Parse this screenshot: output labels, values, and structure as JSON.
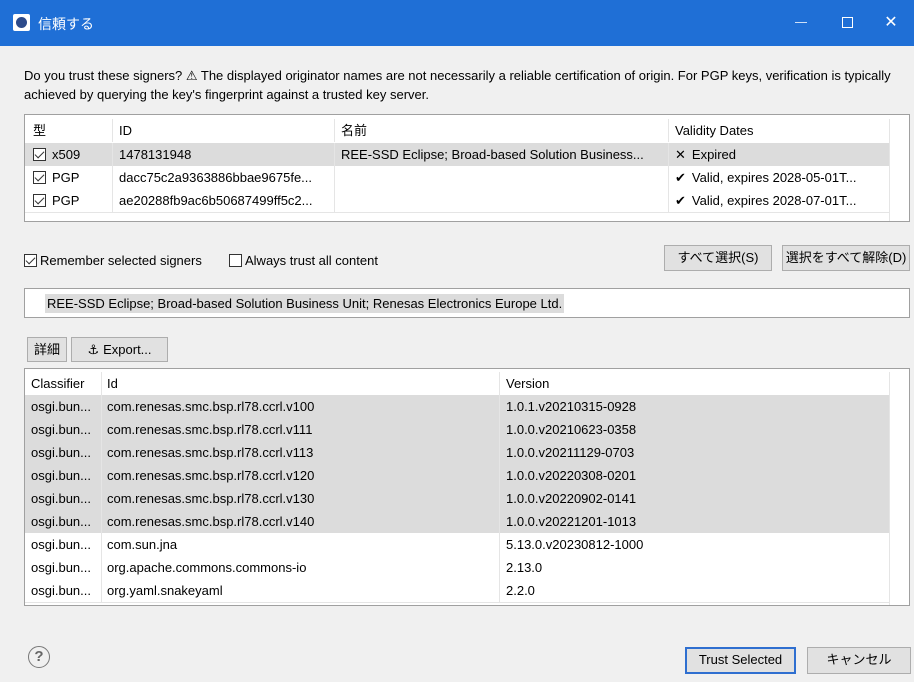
{
  "window": {
    "title": "信頼する"
  },
  "message": "Do you trust these signers?  ⚠ The displayed originator names are not necessarily a reliable certification of origin.  For PGP keys, verification is typically achieved by querying the key's fingerprint against a trusted key server.",
  "signers": {
    "headers": [
      "型",
      "ID",
      "名前",
      "Validity Dates"
    ],
    "rows": [
      {
        "checked": true,
        "type": "x509",
        "id": "1478131948",
        "name": "REE-SSD Eclipse; Broad-based Solution Business...",
        "validity_mark": "✕",
        "validity": "Expired",
        "selected": true
      },
      {
        "checked": true,
        "type": "PGP",
        "id": "dacc75c2a9363886bbae9675fe...",
        "name": "",
        "validity_mark": "✔",
        "validity": "Valid, expires 2028-05-01T...",
        "selected": false
      },
      {
        "checked": true,
        "type": "PGP",
        "id": "ae20288fb9ac6b50687499ff5c2...",
        "name": "",
        "validity_mark": "✔",
        "validity": "Valid, expires 2028-07-01T...",
        "selected": false
      }
    ]
  },
  "options": {
    "remember_label": "Remember selected signers",
    "remember_checked": true,
    "always_trust_label": "Always trust all content",
    "always_trust_checked": false
  },
  "buttons": {
    "select_all": "すべて選択(S)",
    "deselect_all": "選択をすべて解除(D)",
    "details": "詳細",
    "export": "Export...",
    "trust_selected": "Trust Selected",
    "cancel": "キャンセル",
    "help": "?"
  },
  "signer_detail": "REE-SSD Eclipse; Broad-based Solution Business Unit; Renesas Electronics Europe Ltd.",
  "artifacts": {
    "headers": [
      "Classifier",
      "Id",
      "Version"
    ],
    "rows": [
      {
        "classifier": "osgi.bun...",
        "id": "com.renesas.smc.bsp.rl78.ccrl.v100",
        "version": "1.0.1.v20210315-0928",
        "selected": true
      },
      {
        "classifier": "osgi.bun...",
        "id": "com.renesas.smc.bsp.rl78.ccrl.v111",
        "version": "1.0.0.v20210623-0358",
        "selected": true
      },
      {
        "classifier": "osgi.bun...",
        "id": "com.renesas.smc.bsp.rl78.ccrl.v113",
        "version": "1.0.0.v20211129-0703",
        "selected": true
      },
      {
        "classifier": "osgi.bun...",
        "id": "com.renesas.smc.bsp.rl78.ccrl.v120",
        "version": "1.0.0.v20220308-0201",
        "selected": true
      },
      {
        "classifier": "osgi.bun...",
        "id": "com.renesas.smc.bsp.rl78.ccrl.v130",
        "version": "1.0.0.v20220902-0141",
        "selected": true
      },
      {
        "classifier": "osgi.bun...",
        "id": "com.renesas.smc.bsp.rl78.ccrl.v140",
        "version": "1.0.0.v20221201-1013",
        "selected": true
      },
      {
        "classifier": "osgi.bun...",
        "id": "com.sun.jna",
        "version": "5.13.0.v20230812-1000",
        "selected": false
      },
      {
        "classifier": "osgi.bun...",
        "id": "org.apache.commons.commons-io",
        "version": "2.13.0",
        "selected": false
      },
      {
        "classifier": "osgi.bun...",
        "id": "org.yaml.snakeyaml",
        "version": "2.2.0",
        "selected": false
      }
    ]
  }
}
